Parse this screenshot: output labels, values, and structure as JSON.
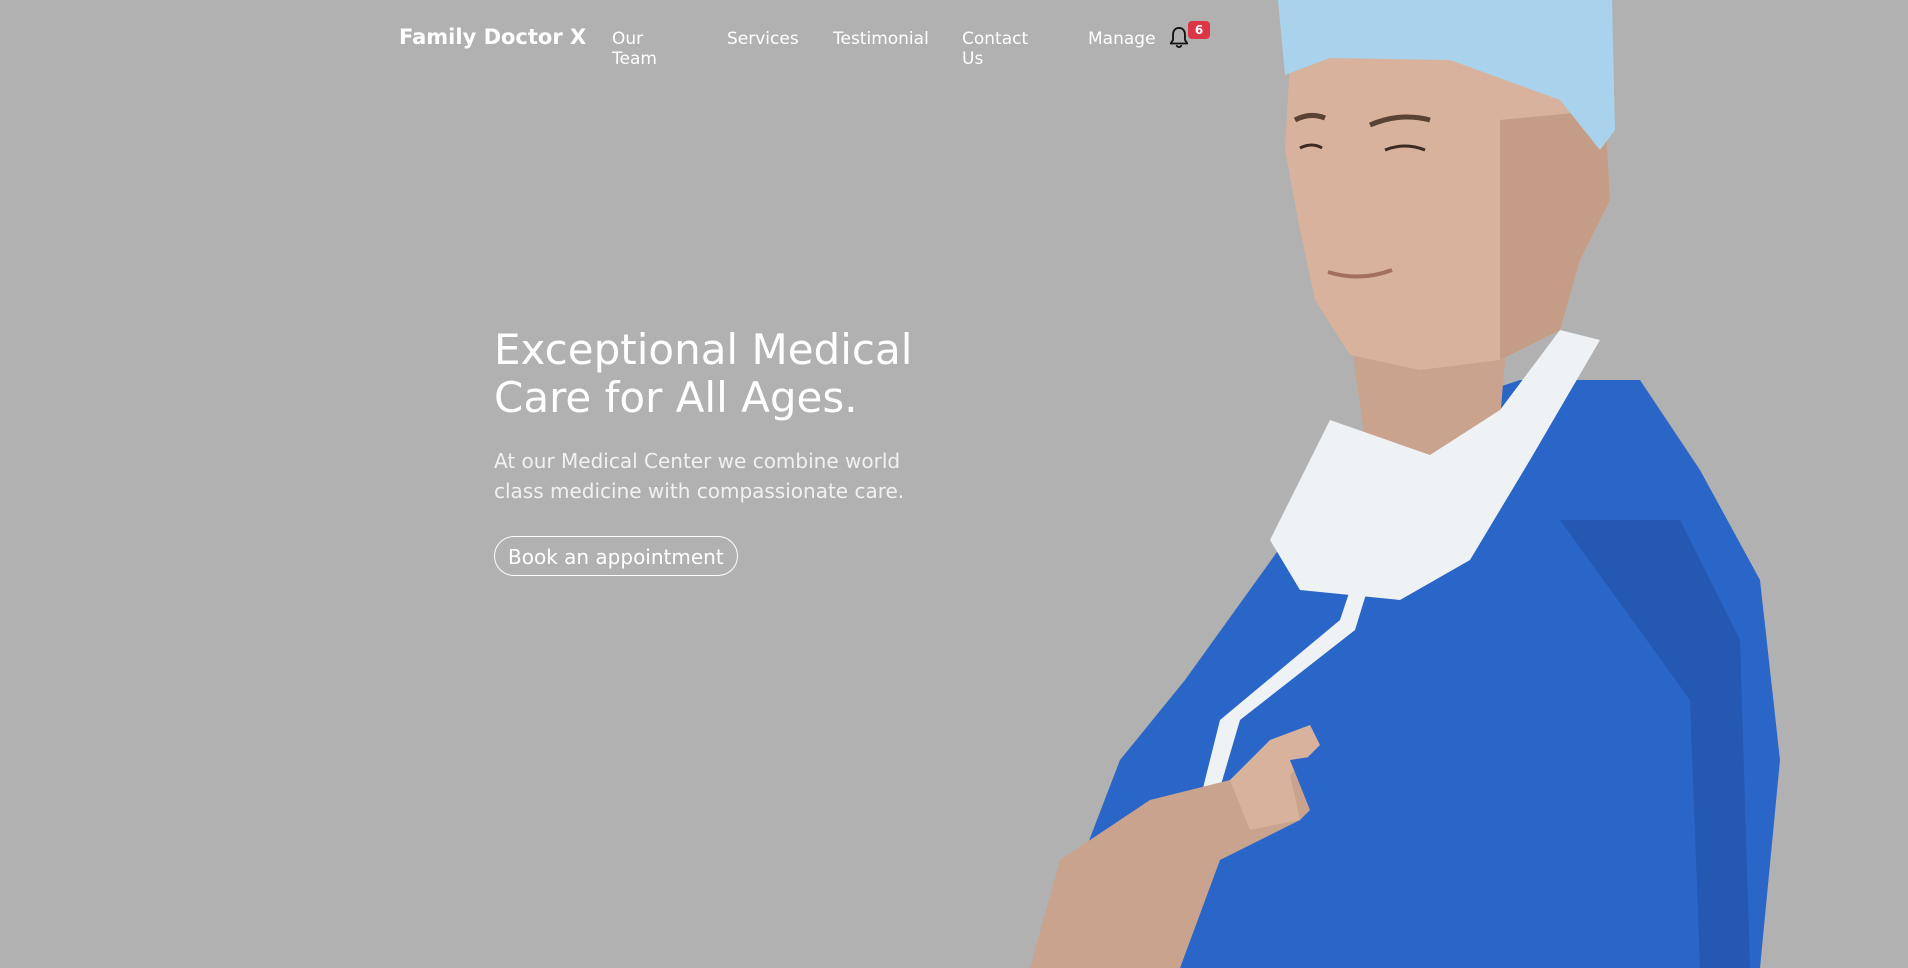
{
  "navbar": {
    "brand": "Family Doctor X",
    "links": [
      {
        "label": "Our Team"
      },
      {
        "label": "Services"
      },
      {
        "label": "Testimonial"
      },
      {
        "label": "Contact Us"
      },
      {
        "label": "Manage"
      }
    ],
    "notifications": {
      "icon": "bell-icon",
      "count": "6"
    }
  },
  "hero": {
    "title_line1": "Exceptional Medical",
    "title_line2": "Care for All Ages.",
    "subtitle_line1": "At our Medical Center we combine world",
    "subtitle_line2": "class medicine with compassionate care.",
    "cta_label": "Book an appointment"
  },
  "colors": {
    "background": "#b1b1b1",
    "text": "#ffffff",
    "badge": "#dc3545",
    "scrubs": "#2a66c8",
    "cap": "#a9d3ec"
  }
}
